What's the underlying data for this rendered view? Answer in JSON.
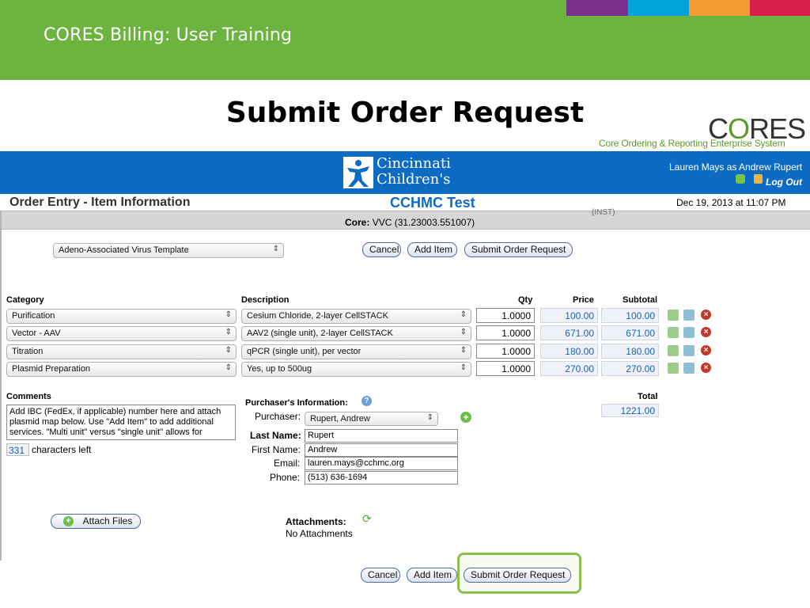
{
  "slide": {
    "title": "CORES Billing: User Training",
    "heading": "Submit Order Request",
    "strip_colors": [
      "#7b2f8e",
      "#00a3d9",
      "#f39c33",
      "#d6204b"
    ]
  },
  "logo": {
    "cores_text_pre": "C",
    "cores_text_o": "O",
    "cores_text_post": "RES",
    "cores_subtitle": "Core Ordering & Reporting Enterprise System",
    "hospital_line1": "Cincinnati",
    "hospital_line2": "Children's"
  },
  "user": {
    "label": "Lauren Mays as Andrew Rupert",
    "logout": "Log Out"
  },
  "page": {
    "title": "Order Entry - Item Information",
    "app_name": "CCHMC Test",
    "datetime": "Dec 19, 2013 at 11:07 PM",
    "core_label": "Core:",
    "core_value": "VVC (31.23003.551007)",
    "ghost_text": "(INST)"
  },
  "template_select": "Adeno-Associated Virus Template",
  "buttons": {
    "cancel": "Cancel",
    "add_item": "Add Item",
    "submit": "Submit Order Request",
    "attach": "Attach Files"
  },
  "table": {
    "headers": {
      "category": "Category",
      "description": "Description",
      "qty": "Qty",
      "price": "Price",
      "subtotal": "Subtotal"
    },
    "rows": [
      {
        "category": "Purification",
        "description": "Cesium Chloride, 2-layer CellSTACK",
        "qty": "1.0000",
        "price": "100.00",
        "subtotal": "100.00"
      },
      {
        "category": "Vector - AAV",
        "description": "AAV2 (single unit), 2-layer CellSTACK",
        "qty": "1.0000",
        "price": "671.00",
        "subtotal": "671.00"
      },
      {
        "category": "Titration",
        "description": "qPCR (single unit), per vector",
        "qty": "1.0000",
        "price": "180.00",
        "subtotal": "180.00"
      },
      {
        "category": "Plasmid Preparation",
        "description": "Yes, up to 500ug",
        "qty": "1.0000",
        "price": "270.00",
        "subtotal": "270.00"
      }
    ],
    "total_label": "Total",
    "total": "1221.00"
  },
  "comments": {
    "label": "Comments",
    "text": "Add IBC (FedEx, if applicable) number here and attach plasmid map below. Use \"Add Item\" to add additional services. \"Multi unit\" versus \"single unit\" allows for",
    "chars_left_count": "331",
    "chars_left_label": "characters left"
  },
  "purchaser": {
    "section_label": "Purchaser's Information:",
    "purchaser_label": "Purchaser:",
    "purchaser_value": "Rupert, Andrew",
    "last_name_label": "Last Name:",
    "last_name": "Rupert",
    "first_name_label": "First Name:",
    "first_name": "Andrew",
    "email_label": "Email:",
    "email": "lauren.mays@cchmc.org",
    "phone_label": "Phone:",
    "phone": "(513) 636-1694"
  },
  "attachments": {
    "label": "Attachments:",
    "value": "No Attachments"
  }
}
